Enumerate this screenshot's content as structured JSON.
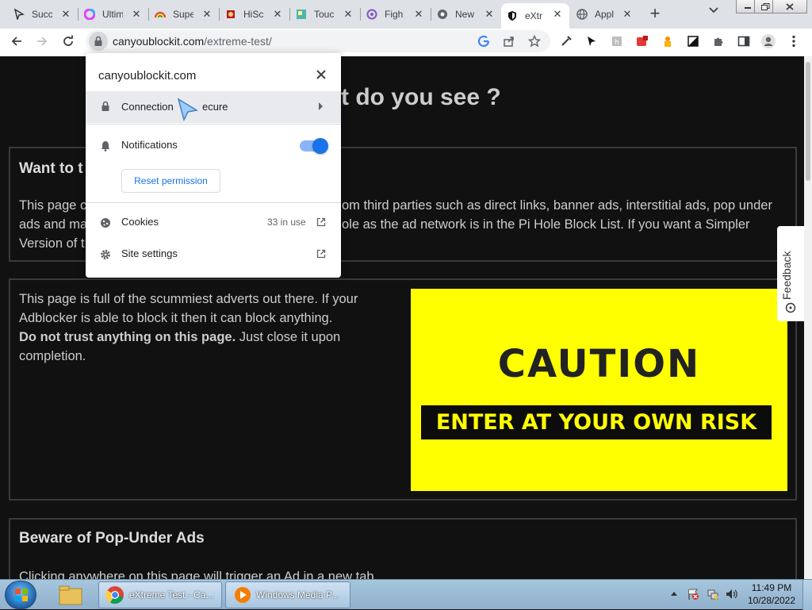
{
  "tabs": [
    {
      "title": "Succ",
      "icon": "arrow-cursor-icon"
    },
    {
      "title": "Ultim",
      "icon": "color-wheel-icon"
    },
    {
      "title": "Supe",
      "icon": "rainbow-icon"
    },
    {
      "title": "HiSc",
      "icon": "hiscore-icon"
    },
    {
      "title": "Touc",
      "icon": "map-icon"
    },
    {
      "title": "Figh",
      "icon": "fight-icon"
    },
    {
      "title": "New",
      "icon": "chrome-icon"
    },
    {
      "title": "eXtr",
      "icon": "shield-icon",
      "active": true
    },
    {
      "title": "Appl",
      "icon": "globe-icon"
    }
  ],
  "address_bar": {
    "domain": "canyoublockit.com",
    "path": "/extreme-test/"
  },
  "site_info_popup": {
    "site": "canyoublockit.com",
    "connection_label": "Connection is secure",
    "connection_visible_prefix": "Connection",
    "connection_visible_suffix": "ecure",
    "notifications_label": "Notifications",
    "notifications_enabled": true,
    "reset_permission_label": "Reset permission",
    "cookies_label": "Cookies",
    "cookies_count": "33 in use",
    "site_settings_label": "Site settings"
  },
  "page": {
    "heading_visible": "t do you see ?",
    "box1_title_visible": "Want to t",
    "box1_lines": [
      [
        "This page c",
        "om third parties such as direct links, banner ads, interstitial ads, pop under"
      ],
      [
        "ads and ma",
        "ole as the ad network is in the Pi Hole Block List. If you want a Simpler"
      ],
      [
        "Version of t",
        ""
      ]
    ],
    "box2_line1": "This page is full of the scummiest adverts out there. If your",
    "box2_line2": "Adblocker is able to block it then it can block anything.",
    "box2_bold": "Do not trust anything on this page.",
    "box2_rest": " Just close it upon",
    "box2_line4": "completion.",
    "caution_title": "CAUTION",
    "caution_subtitle": "ENTER AT YOUR OWN RISK",
    "box3_title": "Beware of Pop-Under Ads",
    "box3_text_partial": "Clicking anywhere on this page will trigger an Ad in a new tab",
    "feedback_label": "Feedback"
  },
  "taskbar": {
    "chrome_title": "eXtreme Test - Ca...",
    "wmp_title": "Windows Media P...",
    "time": "11:49 PM",
    "date": "10/28/2022"
  },
  "colors": {
    "caution_bg": "#ffff00",
    "page_bg": "#111111",
    "toggle_on": "#1a73e8"
  }
}
